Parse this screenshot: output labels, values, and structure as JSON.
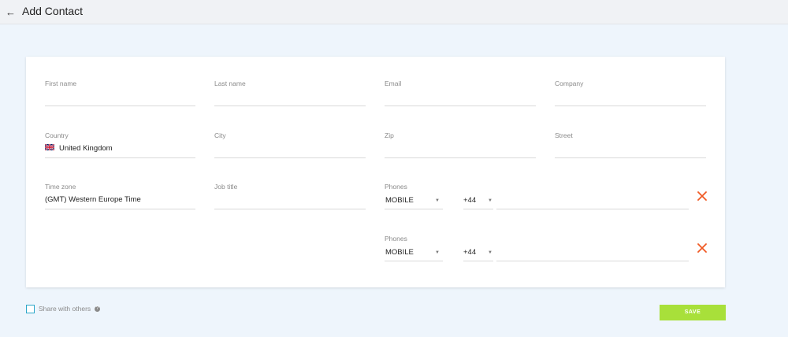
{
  "header": {
    "back_icon": "arrow-left-icon",
    "title": "Add Contact"
  },
  "form": {
    "first_name": {
      "label": "First name",
      "value": ""
    },
    "last_name": {
      "label": "Last name",
      "value": ""
    },
    "email": {
      "label": "Email",
      "value": ""
    },
    "company": {
      "label": "Company",
      "value": ""
    },
    "country": {
      "label": "Country",
      "value": "United Kingdom",
      "flag_icon": "uk-flag-icon"
    },
    "city": {
      "label": "City",
      "value": ""
    },
    "zip": {
      "label": "Zip",
      "value": ""
    },
    "street": {
      "label": "Street",
      "value": ""
    },
    "timezone": {
      "label": "Time zone",
      "value": "(GMT) Western Europe Time"
    },
    "job_title": {
      "label": "Job title",
      "value": ""
    },
    "phones": [
      {
        "label": "Phones",
        "type": "MOBILE",
        "code": "+44",
        "number": ""
      },
      {
        "label": "Phones",
        "type": "MOBILE",
        "code": "+44",
        "number": ""
      }
    ]
  },
  "footer": {
    "share_label": "Share with others",
    "help_icon": "question-circle-icon",
    "save_label": "SAVE"
  },
  "colors": {
    "accent_save": "#a8e03a",
    "remove_x": "#f05a24",
    "checkbox_border": "#2aa6c8",
    "page_bg": "#eef5fc"
  }
}
